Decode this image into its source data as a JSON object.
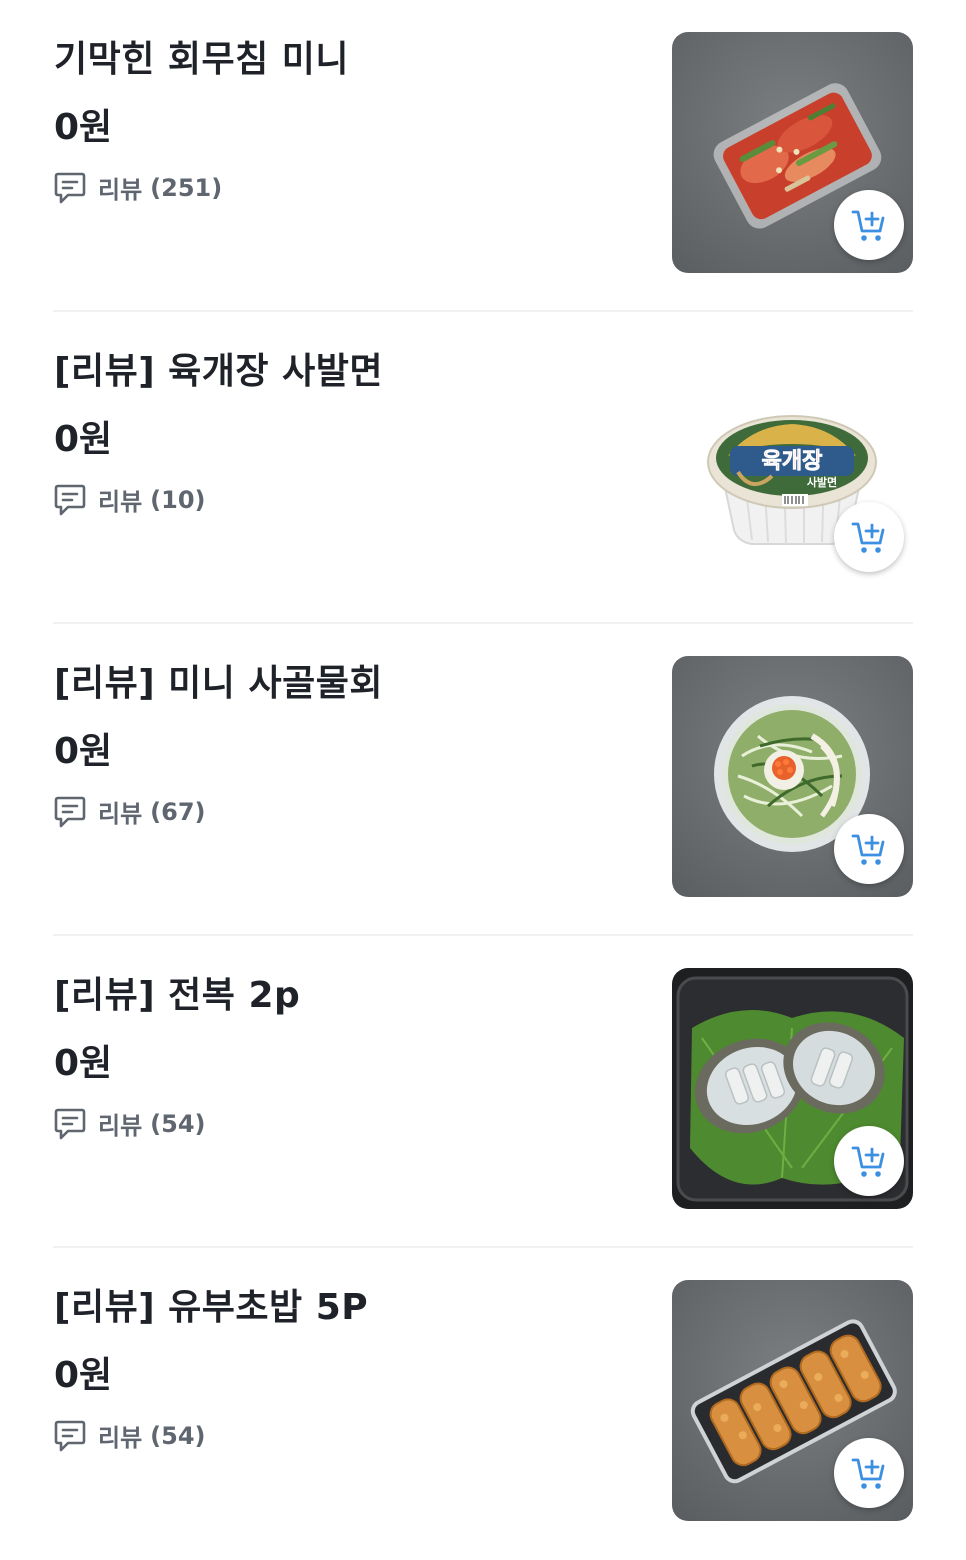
{
  "products": [
    {
      "title": "기막힌 회무침 미니",
      "price": "0원",
      "review_label": "리뷰",
      "review_count": "(251)",
      "image": "spicy-raw-fish-salad-tray"
    },
    {
      "title": "[리뷰] 육개장 사발면",
      "price": "0원",
      "review_label": "리뷰",
      "review_count": "(10)",
      "image": "cup-noodle",
      "image_text": "육개장",
      "image_subtext": "사발면"
    },
    {
      "title": "[리뷰] 미니 사골물회",
      "price": "0원",
      "review_label": "리뷰",
      "review_count": "(67)",
      "image": "cold-raw-fish-soup-bowl"
    },
    {
      "title": "[리뷰] 전복 2p",
      "price": "0원",
      "review_label": "리뷰",
      "review_count": "(54)",
      "image": "abalone-tray"
    },
    {
      "title": "[리뷰] 유부초밥 5P",
      "price": "0원",
      "review_label": "리뷰",
      "review_count": "(54)",
      "image": "fried-tofu-sushi-tray"
    }
  ],
  "icons": {
    "review": "speech-bubble-icon",
    "cart": "add-to-cart-icon"
  },
  "colors": {
    "text_primary": "#1f2329",
    "text_secondary": "#5f6670",
    "cart_accent": "#3d8fe0",
    "divider": "#f0f1f3",
    "photo_background": "#6f7275"
  }
}
